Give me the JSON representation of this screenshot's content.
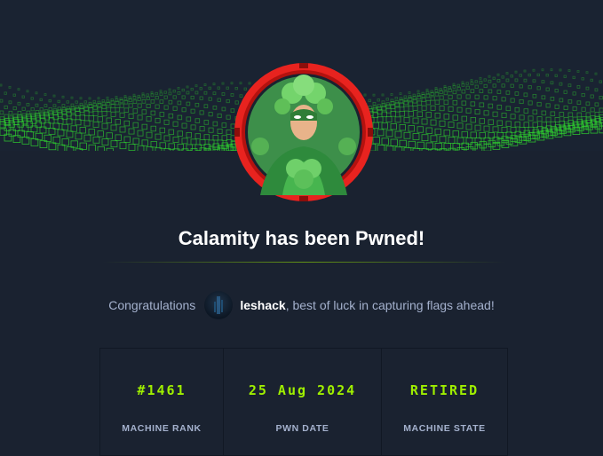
{
  "header": {
    "banner_icon": "green-data-wave-banner"
  },
  "machine": {
    "avatar_icon": "clover-hero-avatar",
    "ring_color": "#e8231f"
  },
  "title": "Calamity has been Pwned!",
  "congrats": {
    "prefix": "Congratulations",
    "username": "leshack",
    "suffix": ", best of luck in capturing flags ahead!"
  },
  "stats": [
    {
      "value": "#1461",
      "label": "MACHINE RANK"
    },
    {
      "value": "25 Aug 2024",
      "label": "PWN DATE"
    },
    {
      "value": "RETIRED",
      "label": "MACHINE STATE"
    }
  ],
  "colors": {
    "accent": "#9fef00",
    "background": "#1a2230",
    "muted_text": "#a4b1cd"
  }
}
